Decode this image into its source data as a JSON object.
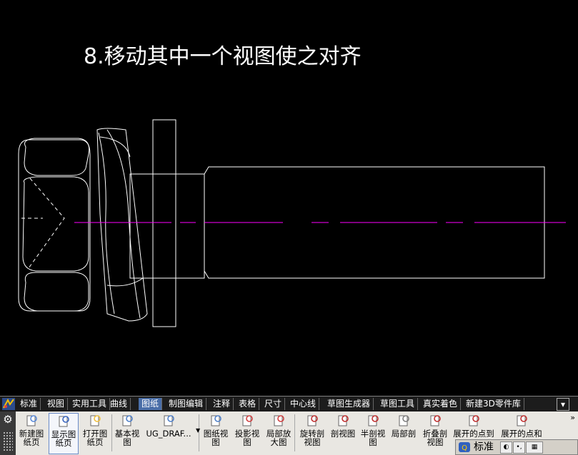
{
  "slide": {
    "title": "8.移动其中一个视图使之对齐"
  },
  "colors": {
    "line": "#ffffff",
    "centerline": "#ff00ff",
    "background": "#000000",
    "tab_active": "#4a6ea8"
  },
  "tabs": [
    "标准",
    "视图",
    "实用工具",
    "曲线",
    "图纸",
    "制图编辑",
    "注释",
    "表格",
    "尺寸",
    "中心线",
    "草图生成器",
    "草图工具",
    "真实着色",
    "新建3D零件库"
  ],
  "active_tab": "图纸",
  "buttons": [
    {
      "line1": "新建图",
      "line2": "纸页",
      "icon": "new-sheet-icon"
    },
    {
      "line1": "显示图",
      "line2": "纸页",
      "icon": "display-sheet-icon"
    },
    {
      "line1": "打开图",
      "line2": "纸页",
      "icon": "open-sheet-icon"
    },
    {
      "line1": "基本视",
      "line2": "图",
      "icon": "base-view-icon"
    },
    {
      "line1": "UG_DRAF...",
      "line2": "",
      "icon": "ug-draft-icon"
    },
    {
      "line1": "图纸视",
      "line2": "图",
      "icon": "drawing-view-icon"
    },
    {
      "line1": "投影视",
      "line2": "图",
      "icon": "projected-view-icon"
    },
    {
      "line1": "局部放",
      "line2": "大图",
      "icon": "detail-view-icon"
    },
    {
      "line1": "旋转剖",
      "line2": "视图",
      "icon": "revolved-section-icon"
    },
    {
      "line1": "剖视图",
      "line2": "",
      "icon": "section-view-icon"
    },
    {
      "line1": "半剖视",
      "line2": "图",
      "icon": "half-section-icon"
    },
    {
      "line1": "局部剖",
      "line2": "",
      "icon": "break-out-section-icon"
    },
    {
      "line1": "折叠剖",
      "line2": "视图",
      "icon": "folded-section-icon"
    },
    {
      "line1": "展开的点到",
      "line2": "",
      "icon": "unfolded-point-icon"
    },
    {
      "line1": "展开的点和",
      "line2": "",
      "icon": "unfolded-point-angle-icon"
    }
  ],
  "status": {
    "text": "标准"
  }
}
